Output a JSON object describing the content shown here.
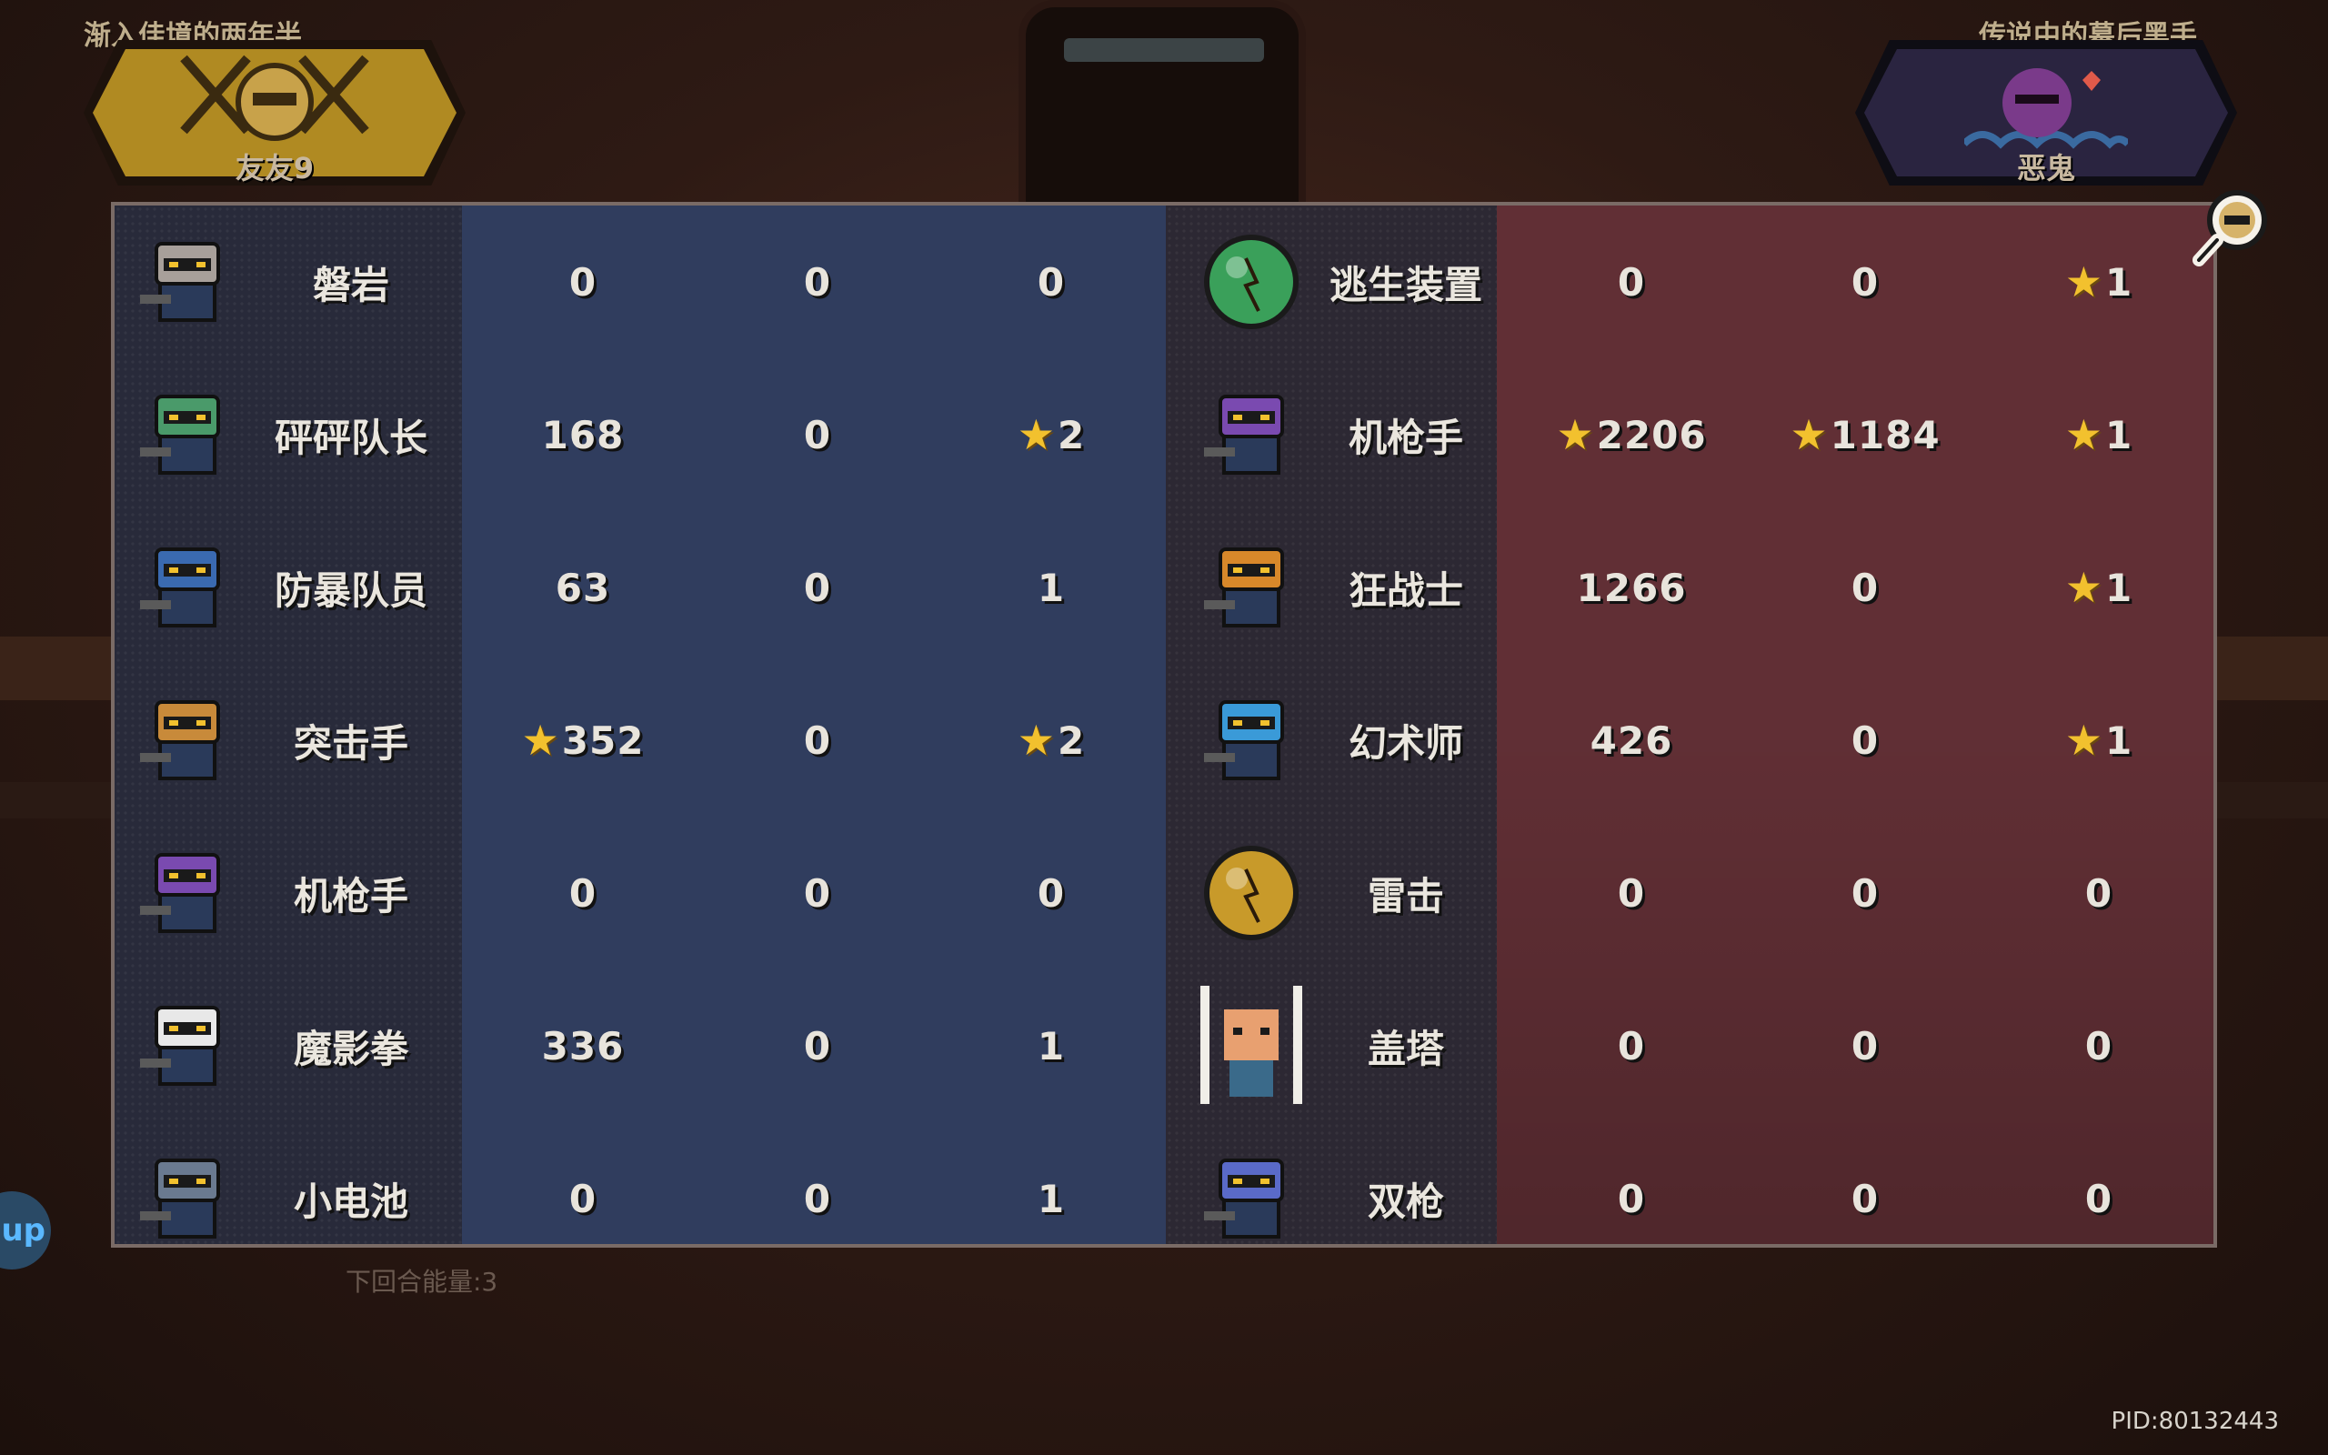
{
  "players": {
    "left": {
      "title": "渐入佳境的两年半",
      "name": "友友9"
    },
    "right": {
      "title": "传说中的幕后黑手",
      "name": "恶鬼"
    }
  },
  "left_rows": [
    {
      "name": "磐岩",
      "v1": "0",
      "v1_star": false,
      "v2": "0",
      "v2_star": false,
      "v3": "0",
      "v3_star": false
    },
    {
      "name": "砰砰队长",
      "v1": "168",
      "v1_star": false,
      "v2": "0",
      "v2_star": false,
      "v3": "2",
      "v3_star": true
    },
    {
      "name": "防暴队员",
      "v1": "63",
      "v1_star": false,
      "v2": "0",
      "v2_star": false,
      "v3": "1",
      "v3_star": false
    },
    {
      "name": "突击手",
      "v1": "352",
      "v1_star": true,
      "v2": "0",
      "v2_star": false,
      "v3": "2",
      "v3_star": true
    },
    {
      "name": "机枪手",
      "v1": "0",
      "v1_star": false,
      "v2": "0",
      "v2_star": false,
      "v3": "0",
      "v3_star": false
    },
    {
      "name": "魔影拳",
      "v1": "336",
      "v1_star": false,
      "v2": "0",
      "v2_star": false,
      "v3": "1",
      "v3_star": false
    },
    {
      "name": "小电池",
      "v1": "0",
      "v1_star": false,
      "v2": "0",
      "v2_star": false,
      "v3": "1",
      "v3_star": false
    }
  ],
  "right_rows": [
    {
      "name": "逃生装置",
      "v1": "0",
      "v1_star": false,
      "v2": "0",
      "v2_star": false,
      "v3": "1",
      "v3_star": true
    },
    {
      "name": "机枪手",
      "v1": "2206",
      "v1_star": true,
      "v2": "1184",
      "v2_star": true,
      "v3": "1",
      "v3_star": true
    },
    {
      "name": "狂战士",
      "v1": "1266",
      "v1_star": false,
      "v2": "0",
      "v2_star": false,
      "v3": "1",
      "v3_star": true
    },
    {
      "name": "幻术师",
      "v1": "426",
      "v1_star": false,
      "v2": "0",
      "v2_star": false,
      "v3": "1",
      "v3_star": true
    },
    {
      "name": "雷击",
      "v1": "0",
      "v1_star": false,
      "v2": "0",
      "v2_star": false,
      "v3": "0",
      "v3_star": false
    },
    {
      "name": "盖塔",
      "v1": "0",
      "v1_star": false,
      "v2": "0",
      "v2_star": false,
      "v3": "0",
      "v3_star": false
    },
    {
      "name": "双枪",
      "v1": "0",
      "v1_star": false,
      "v2": "0",
      "v2_star": false,
      "v3": "0",
      "v3_star": false
    }
  ],
  "left_icons": [
    "rock-golem-icon",
    "captain-icon",
    "riot-guard-icon",
    "assault-icon",
    "gunner-icon",
    "shadow-fist-icon",
    "battery-icon"
  ],
  "right_icons": [
    "escape-pod-icon",
    "gunner-icon",
    "berserker-icon",
    "wizard-icon",
    "thunder-orb-icon",
    "gaeta-icon",
    "dual-gun-icon"
  ],
  "footer": {
    "next_energy": "下回合能量:3",
    "pid": "PID:80132443",
    "side_tab": "up"
  },
  "colors": {
    "star": "#f2c12e",
    "left_value_bg": "#303d5e",
    "right_value_bg": "#612f35"
  }
}
